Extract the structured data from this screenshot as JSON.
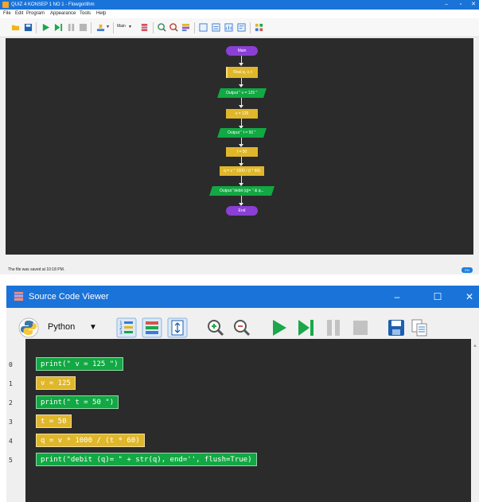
{
  "top_window": {
    "title": "QUIZ 4 KONSEP 1 NO 1 - Flowgorithm",
    "controls": {
      "minimize": "–",
      "maximize": "▫",
      "close": "✕"
    },
    "menu": [
      "File",
      "Edit",
      "Program",
      "Appearance",
      "Tools",
      "Help"
    ],
    "function_select": "Main",
    "status_message": "The file was saved at 10:18 PM.",
    "language_badge": "EN",
    "flowchart": {
      "start": "Main",
      "nodes": [
        {
          "kind": "declare",
          "text": "Real q, v, t"
        },
        {
          "kind": "output",
          "text": "Output \" v = 125 \""
        },
        {
          "kind": "assign",
          "text": "v = 125"
        },
        {
          "kind": "output",
          "text": "Output \" t = 50 \""
        },
        {
          "kind": "assign",
          "text": "t = 50"
        },
        {
          "kind": "assign",
          "text": "q = v * 1000 / (t * 60)"
        },
        {
          "kind": "output",
          "text": "Output \"debit (q)= \" & q..."
        }
      ],
      "end": "End"
    }
  },
  "scv_window": {
    "title": "Source Code Viewer",
    "controls": {
      "minimize": "–",
      "maximize": "☐",
      "close": "✕"
    },
    "language": "Python",
    "colors": {
      "output": "#12a843",
      "assign": "#e0b72a",
      "titlebar": "#1a73d9",
      "editor_bg": "#2b2b2b"
    },
    "code": [
      {
        "line": "0",
        "text": "print(\" v = 125 \")",
        "kind": "output"
      },
      {
        "line": "1",
        "text": "v = 125",
        "kind": "assign"
      },
      {
        "line": "2",
        "text": "print(\" t = 50 \")",
        "kind": "output"
      },
      {
        "line": "3",
        "text": "t = 50",
        "kind": "assign"
      },
      {
        "line": "4",
        "text": "q = v * 1000 / (t * 60)",
        "kind": "assign"
      },
      {
        "line": "5",
        "text": "print(\"debit (q)= \" + str(q), end='', flush=True)",
        "kind": "output"
      }
    ]
  }
}
